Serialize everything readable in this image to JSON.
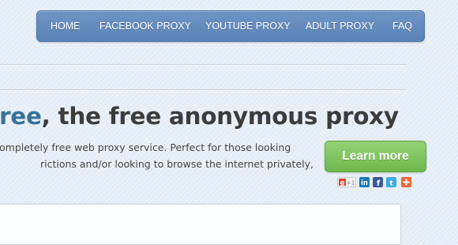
{
  "nav": {
    "items": [
      {
        "label": "HOME"
      },
      {
        "label": "FACEBOOK PROXY"
      },
      {
        "label": "YOUTUBE PROXY"
      },
      {
        "label": "ADULT PROXY"
      },
      {
        "label": "FAQ"
      }
    ]
  },
  "hero": {
    "title_accent": "ree",
    "title_rest": ", the free anonymous proxy",
    "description_line1": "ompletely free web proxy service. Perfect for those looking",
    "description_line2": "rictions and/or looking to browse the internet privately,",
    "cta_label": "Learn more"
  },
  "share": {
    "gplus_label": "+1",
    "icons": [
      "google-plus",
      "linkedin",
      "facebook",
      "twitter",
      "addthis"
    ]
  },
  "colors": {
    "nav_bg": "#5a83b7",
    "accent_text": "#3a7197",
    "cta_bg": "#7cc25a"
  }
}
